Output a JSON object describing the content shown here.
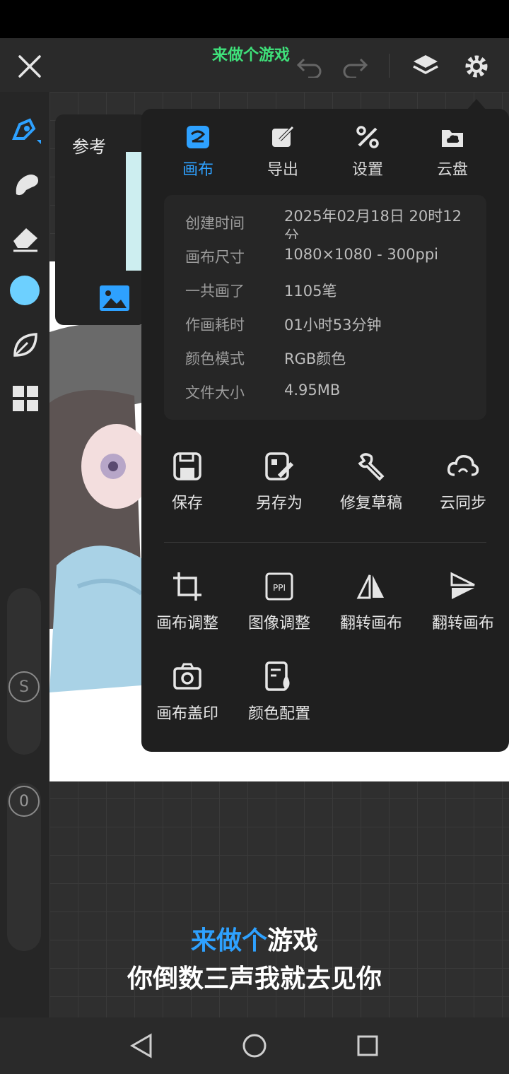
{
  "topbar": {
    "overlay_text": "来做个游戏",
    "icons": [
      "close-icon",
      "undo-icon",
      "redo-icon",
      "layers-icon",
      "gear-icon"
    ]
  },
  "reference_panel": {
    "label": "参考"
  },
  "menu": {
    "tabs": [
      {
        "label": "画布",
        "icon": "canvas-icon",
        "active": true
      },
      {
        "label": "导出",
        "icon": "export-icon",
        "active": false
      },
      {
        "label": "设置",
        "icon": "tools-icon",
        "active": false
      },
      {
        "label": "云盘",
        "icon": "cloud-drive-icon",
        "active": false
      }
    ],
    "info": [
      {
        "label": "创建时间",
        "value": "2025年02月18日 20时12分"
      },
      {
        "label": "画布尺寸",
        "value": "1080×1080 - 300ppi"
      },
      {
        "label": "一共画了",
        "value": "1105笔"
      },
      {
        "label": "作画耗时",
        "value": "01小时53分钟"
      },
      {
        "label": "颜色模式",
        "value": "RGB颜色"
      },
      {
        "label": "文件大小",
        "value": "4.95MB"
      }
    ],
    "actions_row1": [
      "保存",
      "另存为",
      "修复草稿",
      "云同步"
    ],
    "actions_row2": [
      "画布调整",
      "图像调整",
      "翻转画布",
      "翻转画布"
    ],
    "actions_row3": [
      "画布盖印",
      "颜色配置"
    ]
  },
  "sidebar": {
    "brush_size_label": "S",
    "opacity_label": "0",
    "current_color": "#6dd0ff"
  },
  "captions": {
    "line1_highlight": "来做个",
    "line1_rest": "游戏",
    "line2": "你倒数三声我就去见你"
  },
  "colors": {
    "accent": "#2ea1ff",
    "overlay_green": "#3fe07a"
  }
}
